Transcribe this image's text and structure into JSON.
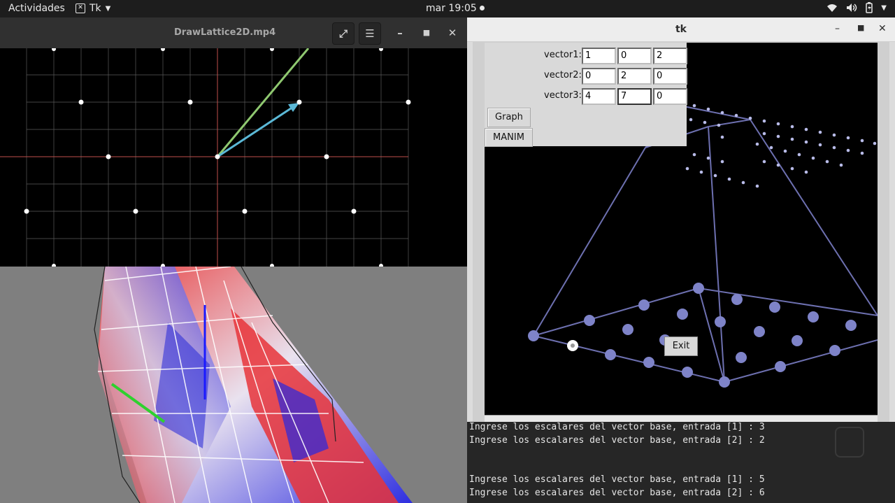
{
  "topbar": {
    "activities": "Actividades",
    "app_name": "Tk",
    "app_icon": "terminal-x-icon",
    "clock": "mar 19:05",
    "tray_icons": [
      "wifi-icon",
      "volume-icon",
      "battery-icon",
      "chevron-down-icon"
    ]
  },
  "video_window": {
    "title": "DrawLattice2D.mp4",
    "buttons": [
      "fullscreen-icon",
      "menu-icon",
      "minimize-icon",
      "maximize-icon",
      "close-icon"
    ]
  },
  "tk_window": {
    "title": "tk",
    "vectors": [
      {
        "label": "vector1:",
        "values": [
          "1",
          "0",
          "2"
        ]
      },
      {
        "label": "vector2:",
        "values": [
          "0",
          "2",
          "0"
        ]
      },
      {
        "label": "vector3:",
        "values": [
          "4",
          "7",
          "0"
        ]
      }
    ],
    "graph_label": "Graph",
    "manim_label": "MANIM",
    "exit_label": "Exit"
  },
  "terminal": {
    "lines": [
      "Ingrese los escalares del vector base, entrada [1] : 3",
      "Ingrese los escalares del vector base, entrada [2] : 2",
      "",
      "",
      "Ingrese los escalares del vector base, entrada [1] : 5",
      "Ingrese los escalares del vector base, entrada [2] : 6"
    ]
  },
  "colors": {
    "grid_axis": "#c0504d",
    "vector_green": "#8fc870",
    "vector_blue": "#5bb8d6",
    "lattice_point": "#7e83c8"
  }
}
